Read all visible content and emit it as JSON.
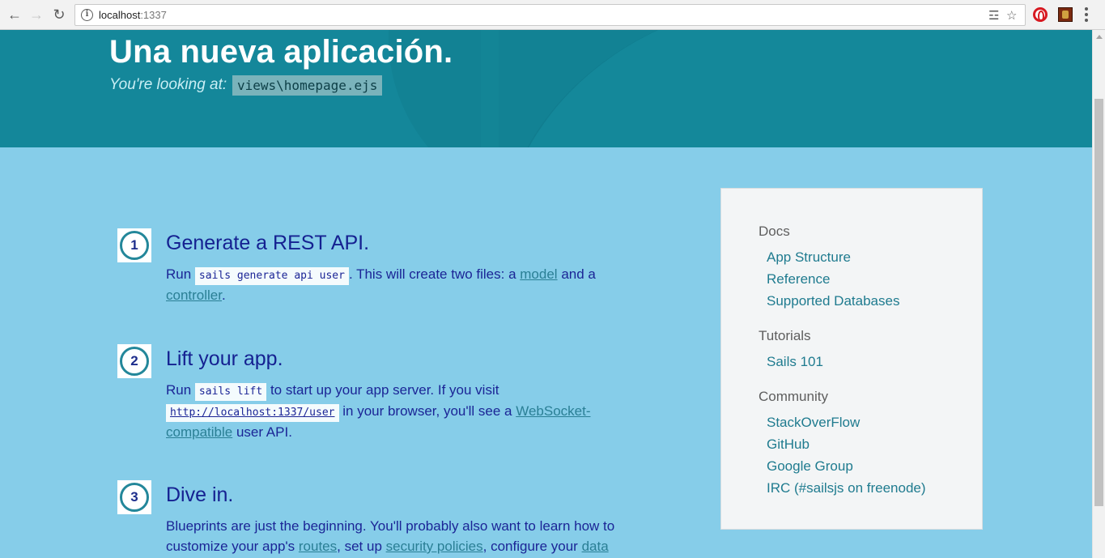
{
  "browser": {
    "url_host": "localhost",
    "url_port": ":1337"
  },
  "hero": {
    "title": "Una nueva aplicación.",
    "looking_label": "You're looking at:",
    "view_file": "views\\homepage.ejs"
  },
  "steps": [
    {
      "number": "1",
      "title": "Generate a REST API.",
      "run": "Run",
      "code": "sails generate api user",
      "text1": ". This will create two files: a",
      "link1": "model",
      "and": "and a",
      "link2": "controller",
      "period": "."
    },
    {
      "number": "2",
      "title": "Lift your app.",
      "run": "Run",
      "code": "sails lift",
      "text1": "to start up your app server. If you visit",
      "code_link": "http://localhost:1337/user",
      "text2": "in your browser, you'll see a",
      "link1": "WebSocket-compatible",
      "text3": "user API."
    },
    {
      "number": "3",
      "title": "Dive in.",
      "text1": "Blueprints are just the beginning. You'll probably also want to learn how to customize your app's",
      "link1": "routes",
      "text2": ", set up",
      "link2": "security policies",
      "text3": ", configure your",
      "link3": "data"
    }
  ],
  "sidebar": {
    "docs_heading": "Docs",
    "docs_links": [
      "App Structure",
      "Reference",
      "Supported Databases"
    ],
    "tutorials_heading": "Tutorials",
    "tutorials_links": [
      "Sails 101"
    ],
    "community_heading": "Community",
    "community_links": [
      "StackOverFlow",
      "GitHub",
      "Google Group",
      "IRC (#sailsjs on freenode)"
    ]
  }
}
